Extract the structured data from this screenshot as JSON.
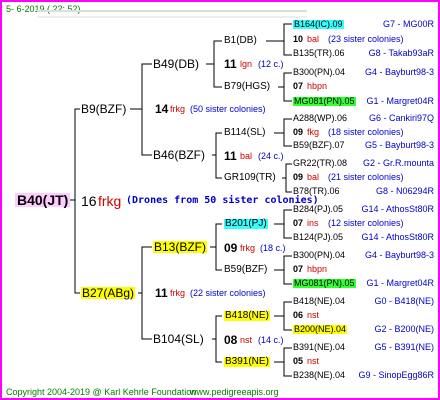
{
  "header": {
    "date": "5-  6-2019 ( 22: 52)",
    "footer_left": "Copyright 2004-2019 @ Karl Kehrle Foundation",
    "footer_right": "www.pedigreeapis.org"
  },
  "root": {
    "name": "B40(JT)",
    "num": "16",
    "code": "frkg",
    "note": "(Drones from 50 sister colonies)"
  },
  "gen1": [
    {
      "name": "B9(BZF)"
    },
    {
      "name": "B27(ABg)"
    }
  ],
  "gen1_mid": [
    {
      "num": "14",
      "code": "frkg",
      "note": "(50 sister colonies)"
    },
    {
      "num": "11",
      "code": "frkg",
      "note": "(22 sister colonies)"
    }
  ],
  "gen2": [
    {
      "name": "B49(DB)"
    },
    {
      "name": "B46(BZF)"
    },
    {
      "name": "B13(BZF)"
    },
    {
      "name": "B104(SL)"
    }
  ],
  "gen2_mid": [
    {
      "num": "11",
      "code": "lgn",
      "note": "(12 c.)"
    },
    {
      "num": "11",
      "code": "bal",
      "note": "(24 c.)"
    },
    {
      "num": "09",
      "code": "frkg",
      "note": "(18 c.)"
    },
    {
      "num": "08",
      "code": "nst",
      "note": "(14 c.)"
    }
  ],
  "gen3": [
    {
      "name": "B1(DB)"
    },
    {
      "name": "B79(HGS)"
    },
    {
      "name": "B114(SL)"
    },
    {
      "name": "GR109(TR)"
    },
    {
      "name": "B201(PJ)"
    },
    {
      "name": "B59(BZF)"
    },
    {
      "name": "B418(NE)"
    },
    {
      "name": "B391(NE)"
    }
  ],
  "gen4": [
    {
      "left": "B164(IC).09",
      "right": "G7 - MG00R",
      "hl": "cyan"
    },
    {
      "num": "10",
      "code": "bal",
      "note": "(23 sister colonies)"
    },
    {
      "left": "B135(TR).06",
      "right": "G8 - Takab93aR"
    },
    {
      "left": "B300(PN).04",
      "right": "G4 - Bayburt98-3"
    },
    {
      "num": "07",
      "code": "hbpn",
      "note": ""
    },
    {
      "left": "MG081(PN).05",
      "right": "G1 - Margret04R",
      "hl": "grn"
    },
    {
      "left": "A288(WP).06",
      "right": "G6 - Cankiri97Q"
    },
    {
      "num": "09",
      "code": "fkg",
      "note": "(18 sister colonies)"
    },
    {
      "left": "B59(BZF).07",
      "right": "G5 - Bayburt98-3"
    },
    {
      "left": "GR22(TR).08",
      "right": "G2 - Gr.R.mounta"
    },
    {
      "num": "09",
      "code": "bal",
      "note": "(21 sister colonies)"
    },
    {
      "left": "B78(TR).06",
      "right": "G8 - N06294R"
    },
    {
      "left": "B284(PJ).05",
      "right": "G14 - AthosSt80R"
    },
    {
      "num": "07",
      "code": "ins",
      "note": "(12 sister colonies)"
    },
    {
      "left": "B124(PJ).05",
      "right": "G14 - AthosSt80R"
    },
    {
      "left": "B300(PN).04",
      "right": "G4 - Bayburt98-3"
    },
    {
      "num": "07",
      "code": "hbpn",
      "note": ""
    },
    {
      "left": "MG081(PN).05",
      "right": "G1 - Margret04R",
      "hl": "grn"
    },
    {
      "left": "B418(NE).04",
      "right": "G0 - B418(NE)"
    },
    {
      "num": "06",
      "code": "nst",
      "note": ""
    },
    {
      "left": "B200(NE).04",
      "right": "G2 - B200(NE)",
      "hl": "yel"
    },
    {
      "left": "B391(NE).04",
      "right": "G5 - B391(NE)"
    },
    {
      "num": "05",
      "code": "nst",
      "note": ""
    },
    {
      "left": "B238(NE).04",
      "right": "G9 - SinopEgg86R"
    }
  ]
}
